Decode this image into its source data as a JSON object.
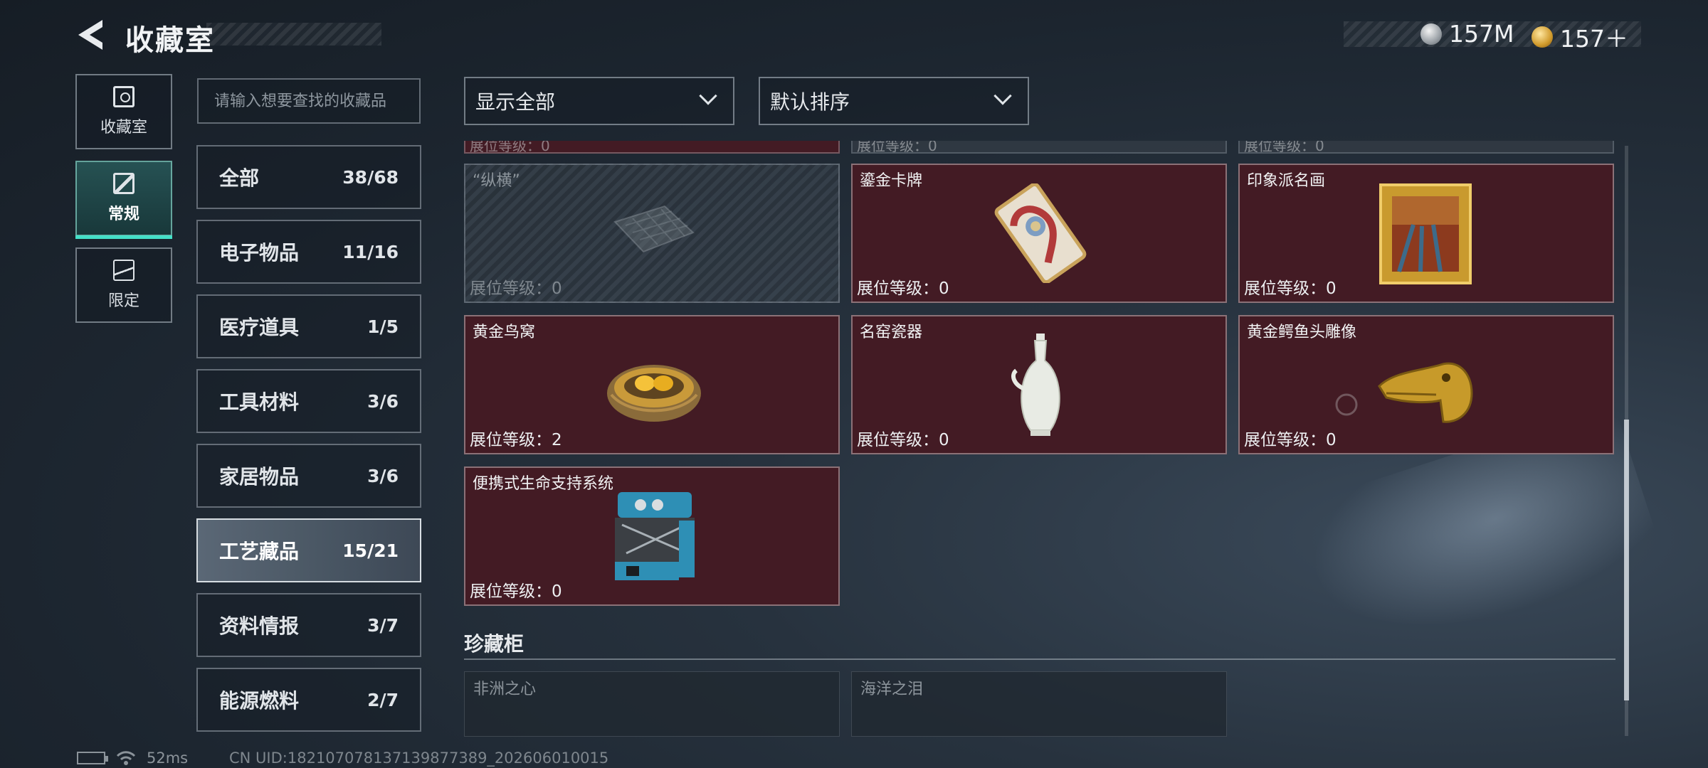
{
  "header": {
    "title": "收藏室",
    "currencies": [
      {
        "icon": "silver-coin-icon",
        "value": "157M"
      },
      {
        "icon": "gold-coin-icon",
        "value": "157＋"
      }
    ]
  },
  "nav": [
    {
      "label": "收藏室",
      "icon": "collection-room-icon",
      "active": false
    },
    {
      "label": "常规",
      "icon": "regular-icon",
      "active": true
    },
    {
      "label": "限定",
      "icon": "limited-icon",
      "active": false
    }
  ],
  "search": {
    "placeholder": "请输入想要查找的收藏品"
  },
  "categories": [
    {
      "name": "全部",
      "count": "38/68"
    },
    {
      "name": "电子物品",
      "count": "11/16"
    },
    {
      "name": "医疗道具",
      "count": "1/5"
    },
    {
      "name": "工具材料",
      "count": "3/6"
    },
    {
      "name": "家居物品",
      "count": "3/6"
    },
    {
      "name": "工艺藏品",
      "count": "15/21",
      "active": true
    },
    {
      "name": "资料情报",
      "count": "3/7"
    },
    {
      "name": "能源燃料",
      "count": "2/7"
    }
  ],
  "filters": {
    "display": "显示全部",
    "sort": "默认排序"
  },
  "partial_row_label": "展位等级：0",
  "items": [
    {
      "name": "“纵横”",
      "level": "展位等级：0",
      "locked": true,
      "icon": "chessboard-icon"
    },
    {
      "name": "鎏金卡牌",
      "level": "展位等级：0",
      "locked": false,
      "icon": "gilded-card-icon"
    },
    {
      "name": "印象派名画",
      "level": "展位等级：0",
      "locked": false,
      "icon": "framed-painting-icon"
    },
    {
      "name": "黄金鸟窝",
      "level": "展位等级：2",
      "locked": false,
      "icon": "golden-nest-icon"
    },
    {
      "name": "名窑瓷器",
      "level": "展位等级：0",
      "locked": false,
      "icon": "porcelain-vase-icon"
    },
    {
      "name": "黄金鳄鱼头雕像",
      "level": "展位等级：0",
      "locked": false,
      "icon": "golden-crocodile-head-icon"
    },
    {
      "name": "便携式生命支持系统",
      "level": "展位等级：0",
      "locked": false,
      "icon": "life-support-system-icon"
    }
  ],
  "cabinet": {
    "title": "珍藏柜",
    "items": [
      {
        "name": "非洲之心",
        "locked": true
      },
      {
        "name": "海洋之泪",
        "locked": true
      }
    ]
  },
  "status": {
    "latency": "52ms",
    "uid": "CN UID:182107078137139877389_202606010015"
  }
}
